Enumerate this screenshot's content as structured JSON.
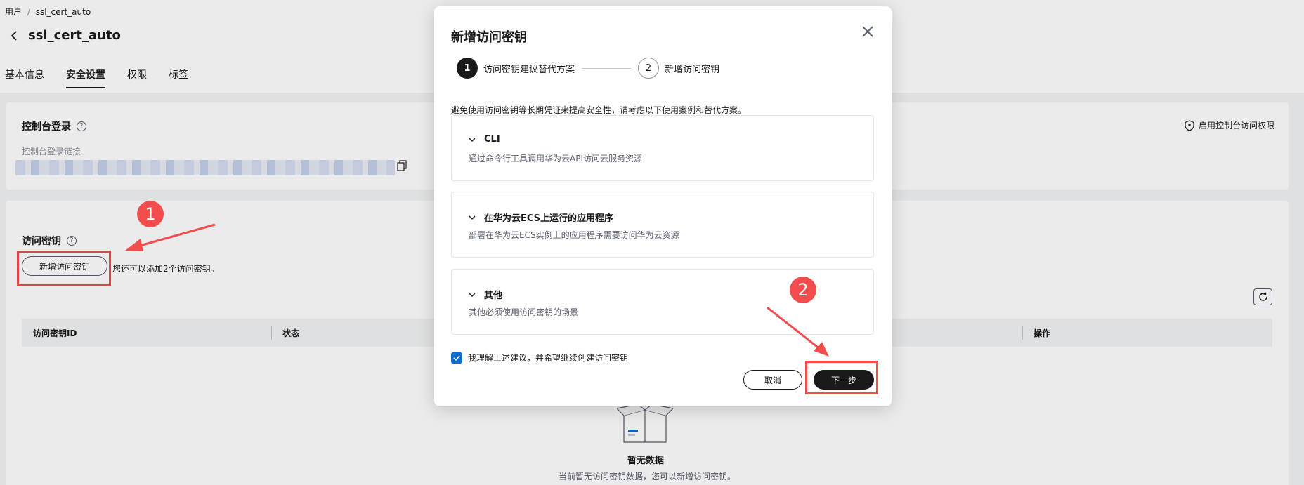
{
  "breadcrumb": {
    "root": "用户",
    "sep": "/",
    "current": "ssl_cert_auto"
  },
  "page": {
    "title": "ssl_cert_auto"
  },
  "tabs": [
    {
      "label": "基本信息"
    },
    {
      "label": "安全设置"
    },
    {
      "label": "权限"
    },
    {
      "label": "标签"
    }
  ],
  "console_login": {
    "title": "控制台登录",
    "link_label": "控制台登录链接",
    "enable_label": "启用控制台访问权限"
  },
  "access_keys": {
    "title": "访问密钥",
    "add_button": "新增访问密钥",
    "remaining": "您还可以添加2个访问密钥。",
    "columns": [
      "访问密钥ID",
      "状态",
      "操作"
    ],
    "empty_title": "暂无数据",
    "empty_subtitle": "当前暂无访问密钥数据，您可以新增访问密钥。"
  },
  "modal": {
    "title": "新增访问密钥",
    "steps": [
      {
        "number": "1",
        "label": "访问密钥建议替代方案"
      },
      {
        "number": "2",
        "label": "新增访问密钥"
      }
    ],
    "notice": "避免使用访问密钥等长期凭证来提高安全性，请考虑以下使用案例和替代方案。",
    "cases": [
      {
        "title": "CLI",
        "desc": "通过命令行工具调用华为云API访问云服务资源"
      },
      {
        "title": "在华为云ECS上运行的应用程序",
        "desc": "部署在华为云ECS实例上的应用程序需要访问华为云资源"
      },
      {
        "title": "其他",
        "desc": "其他必须使用访问密钥的场景"
      }
    ],
    "agree_label": "我理解上述建议，并希望继续创建访问密钥",
    "cancel_label": "取消",
    "next_label": "下一步"
  },
  "annotations": {
    "marker1": "1",
    "marker2": "2",
    "accent_color": "#f24c4c"
  }
}
